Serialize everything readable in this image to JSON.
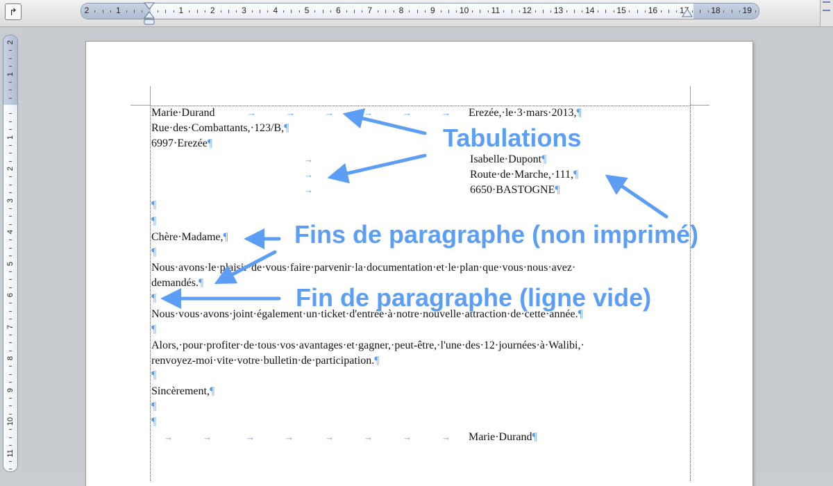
{
  "ruler": {
    "horizontal_numbers": [
      "2",
      "1",
      "",
      "1",
      "2",
      "3",
      "4",
      "5",
      "6",
      "7",
      "8",
      "9",
      "10",
      "11",
      "12",
      "13",
      "14",
      "15",
      "16",
      "17",
      "18",
      "19"
    ],
    "vertical_numbers": [
      "2",
      "1",
      "",
      "1",
      "2",
      "3",
      "4",
      "5",
      "6",
      "7",
      "8",
      "9",
      "10",
      "11"
    ]
  },
  "toolbar": {
    "tab_selector_label": "↱"
  },
  "letter": {
    "sender_name": "Marie·Durand",
    "date": "Erezée,·le·3·mars·2013,",
    "sender_street": "Rue·des·Combattants,·123/B,",
    "sender_city": "6997·Erezée",
    "recipient_name": "Isabelle·Dupont",
    "recipient_street": "Route·de·Marche,·111,",
    "recipient_city": "6650·BASTOGNE",
    "salutation": "Chère·Madame,",
    "paragraph1_line1": "Nous·avons·le·plaisir·de·vous·faire·parvenir·la·documentation·et·le·plan·que·vous·nous·avez·",
    "paragraph1_line2": "demandés.",
    "paragraph2": "Nous·vous·avons·joint·également·un·ticket·d'entrée·à·notre·nouvelle·attraction·de·cette·année.",
    "paragraph3_line1": "Alors,·pour·profiter·de·tous·vos·avantages·et·gagner,·peut-être,·l'une·des·12·journées·à·Walibi,·",
    "paragraph3_line2": "renvoyez-moi·vite·votre·bulletin·de·participation.",
    "closing": "Sincèrement,",
    "signature": "Marie·Durand",
    "pilcrow": "¶",
    "tab_arrow": "→"
  },
  "annotations": {
    "tabs": "Tabulations",
    "para_marks": "Fins de paragraphe (non imprimé)",
    "empty_line": "Fin de paragraphe (ligne vide)"
  },
  "colors": {
    "accent": "#5b9ef4",
    "ruler_margin": "#b5c2d6"
  }
}
